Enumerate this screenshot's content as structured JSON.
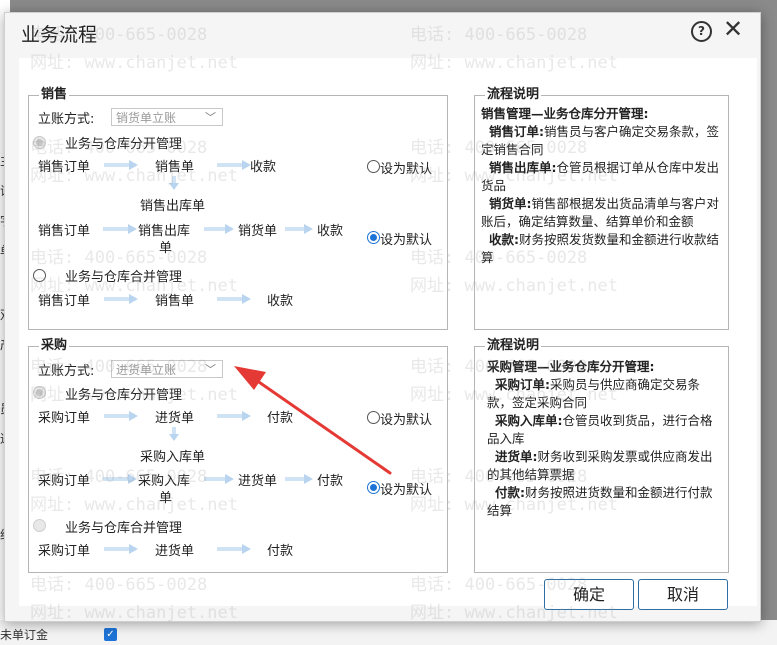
{
  "dialog": {
    "title": "业务流程"
  },
  "watermark": {
    "phone": "电话: 400-665-0028",
    "site": "网址: www.chanjet.net"
  },
  "background": {
    "bottom_text": "未单订金",
    "left_chars": [
      "主",
      "试",
      "字",
      "单",
      "双",
      "产",
      "员",
      "进",
      "约"
    ]
  },
  "sales": {
    "title": "销售",
    "method_label": "立账方式:",
    "method_value": "销货单立账",
    "opt1_label": "业务与仓库分开管理",
    "row1": [
      "销售订单",
      "销售单",
      "收款"
    ],
    "mid_node": "销售出库单",
    "row2": [
      "销售订单",
      "销售出库",
      "单",
      "销货单",
      "收款"
    ],
    "opt2_label": "业务与仓库合并管理",
    "row3": [
      "销售订单",
      "销售单",
      "收款"
    ],
    "default_label": "设为默认"
  },
  "sales_desc": {
    "title": "流程说明",
    "heading": "销售管理—业务仓库分开管理:",
    "items": [
      {
        "term": "销售订单:",
        "text": "销售员与客户确定交易条款，签定销售合同"
      },
      {
        "term": "销售出库单:",
        "text": "仓管员根据订单从仓库中发出货品"
      },
      {
        "term": "销货单:",
        "text": "销售部根据发出货品清单与客户对账后，确定结算数量、结算单价和金额"
      },
      {
        "term": "收款:",
        "text": "财务按照发货数量和金额进行收款结算"
      }
    ]
  },
  "purchase": {
    "title": "采购",
    "method_label": "立账方式:",
    "method_value": "进货单立账",
    "opt1_label": "业务与仓库分开管理",
    "row1": [
      "采购订单",
      "进货单",
      "付款"
    ],
    "mid_node": "采购入库单",
    "row2": [
      "采购订单",
      "采购入库",
      "单",
      "进货单",
      "付款"
    ],
    "opt2_label": "业务与仓库合并管理",
    "row3": [
      "采购订单",
      "进货单",
      "付款"
    ],
    "default_label": "设为默认"
  },
  "purchase_desc": {
    "title": "流程说明",
    "heading": "采购管理—业务仓库分开管理:",
    "items": [
      {
        "term": "采购订单:",
        "text": "采购员与供应商确定交易条款，签定采购合同"
      },
      {
        "term": "采购入库单:",
        "text": "仓管员收到货品，进行合格品入库"
      },
      {
        "term": "进货单:",
        "text": "财务收到采购发票或供应商发出的其他结算票据"
      },
      {
        "term": "付款:",
        "text": "财务按照进货数量和金额进行付款结算"
      }
    ]
  },
  "buttons": {
    "ok": "确定",
    "cancel": "取消"
  },
  "colors": {
    "accent": "#1e73d6",
    "annotation": "#e53935"
  }
}
